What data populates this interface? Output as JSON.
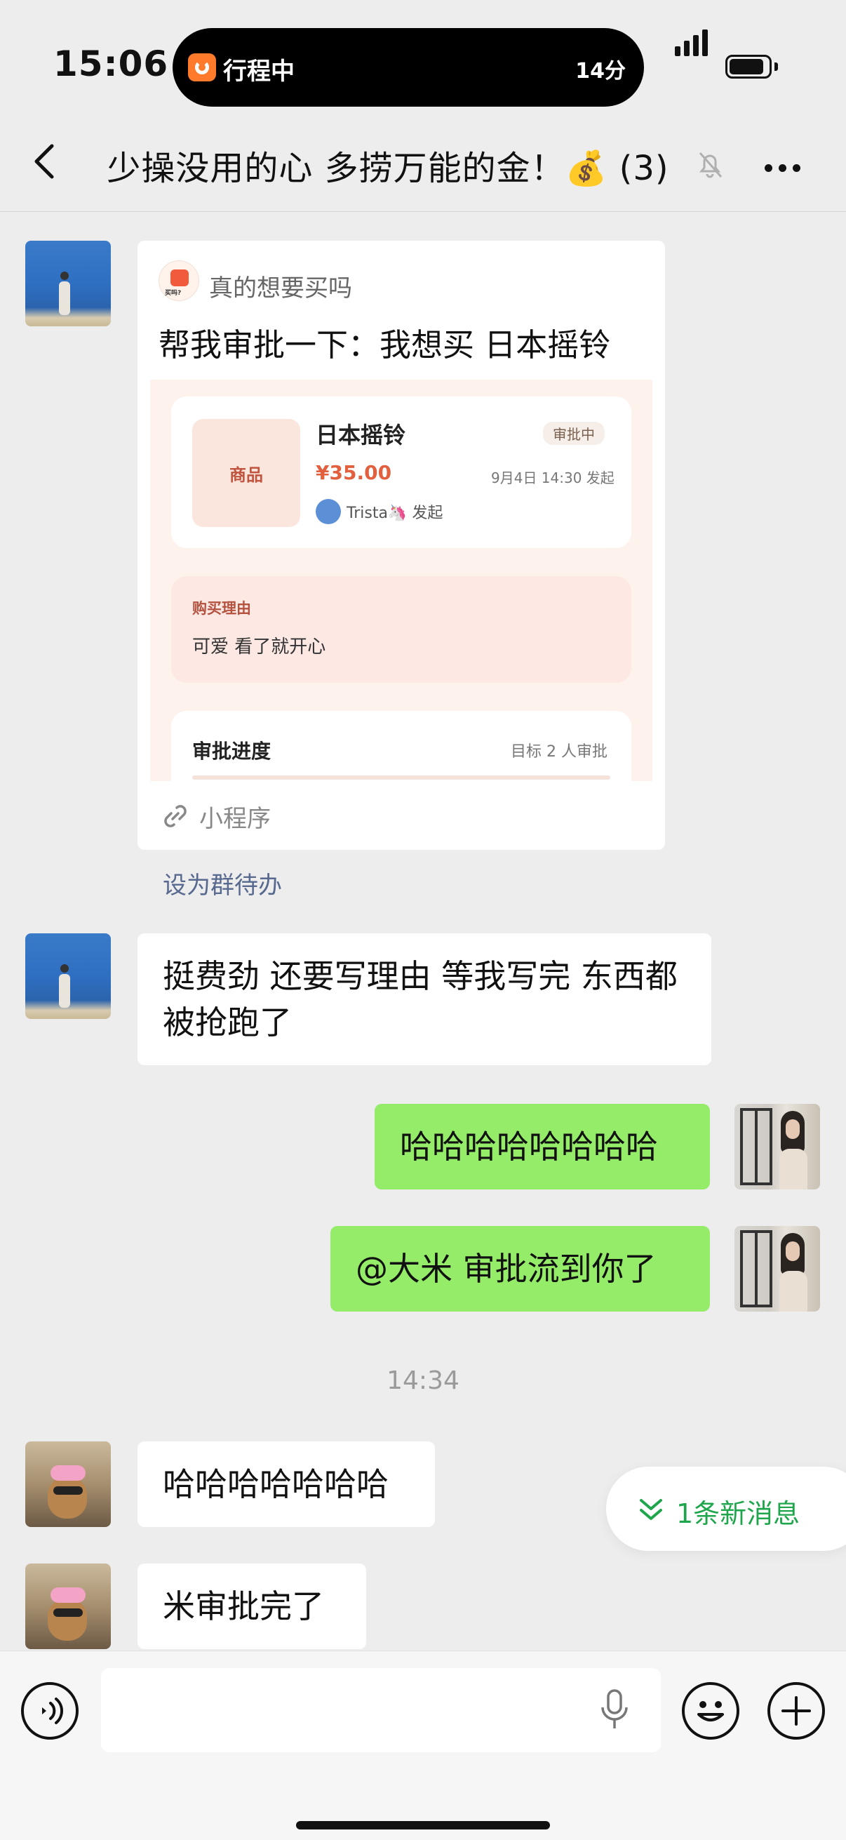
{
  "status_bar": {
    "time": "15:06",
    "live_activity": {
      "label": "行程中",
      "eta": "14分"
    }
  },
  "nav": {
    "title": "少操没用的心 多捞万能的金！💰 (3)"
  },
  "messages": {
    "card": {
      "app_name": "真的想要买吗",
      "app_icon_text": "买吗?",
      "title": "帮我审批一下：我想买 日本摇铃",
      "item_thumb_label": "商品",
      "item_name": "日本摇铃",
      "item_price": "¥35.00",
      "status": "审批中",
      "date": "9月4日 14:30 发起",
      "initiator": "Trista🦄 发起",
      "reason_label": "购买理由",
      "reason_text": "可爱 看了就开心",
      "progress_label": "审批进度",
      "progress_target": "目标 2 人审批",
      "footer_label": "小程序"
    },
    "group_todo_link": "设为群待办",
    "msg1": "挺费劲 还要写理由 等我写完 东西都被抢跑了",
    "msg2": "哈哈哈哈哈哈哈哈",
    "msg3": "@大米 审批流到你了",
    "timestamp": "14:34",
    "msg4": "哈哈哈哈哈哈哈",
    "msg5": "米审批完了"
  },
  "new_messages": {
    "label": "1条新消息"
  },
  "input_bar": {
    "value": ""
  },
  "colors": {
    "my_bubble": "#95ec69",
    "price": "#e2603e",
    "new_msg_text": "#1fa64c",
    "link": "#57698f"
  },
  "icons": [
    "back-icon",
    "mute-bell-icon",
    "more-icon",
    "link-icon",
    "double-chevron-down-icon",
    "voice-icon",
    "mic-icon",
    "emoji-icon",
    "plus-icon"
  ]
}
